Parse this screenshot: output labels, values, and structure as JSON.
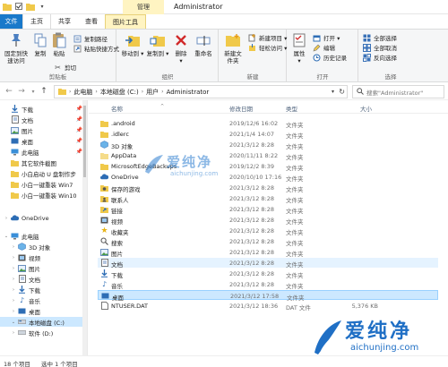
{
  "titlebar": {
    "manage_tab": "管理",
    "title": "Administrator"
  },
  "tabs": {
    "file": "文件",
    "home": "主页",
    "share": "共享",
    "view": "查看",
    "picture_tools": "图片工具"
  },
  "ribbon": {
    "clipboard": {
      "pin_label": "固定到快速访问",
      "copy_label": "复制",
      "paste_label": "粘贴",
      "copy_path_label": "复制路径",
      "paste_shortcut_label": "粘贴快捷方式",
      "cut_label": "剪切",
      "group_label": "剪贴板"
    },
    "organize": {
      "move_to_label": "移动到",
      "copy_to_label": "复制到",
      "delete_label": "删除",
      "rename_label": "重命名",
      "group_label": "组织"
    },
    "new": {
      "new_folder_label": "新建文件夹",
      "new_item_label": "新建项目",
      "easy_access_label": "轻松访问",
      "group_label": "新建"
    },
    "open": {
      "properties_label": "属性",
      "open_label": "打开",
      "edit_label": "编辑",
      "history_label": "历史记录",
      "group_label": "打开"
    },
    "select": {
      "select_all_label": "全部选择",
      "select_none_label": "全部取消",
      "invert_label": "反向选择",
      "group_label": "选择"
    }
  },
  "address": {
    "crumbs": [
      "此电脑",
      "本地磁盘 (C:)",
      "用户",
      "Administrator"
    ],
    "search_placeholder": "搜索\"Administrator\""
  },
  "sidebar": {
    "items": [
      {
        "label": "下载",
        "icon": "download-icon",
        "pinned": true
      },
      {
        "label": "文档",
        "icon": "document-icon",
        "pinned": true
      },
      {
        "label": "图片",
        "icon": "picture-icon",
        "pinned": true
      },
      {
        "label": "桌面",
        "icon": "desktop-icon",
        "pinned": true
      },
      {
        "label": "此电脑",
        "icon": "computer-icon",
        "pinned": true
      },
      {
        "label": "其它软件截图",
        "icon": "folder-icon",
        "pinned": false
      },
      {
        "label": "小白启动 U 盘制作步",
        "icon": "folder-icon",
        "pinned": false
      },
      {
        "label": "小白一键重装 Win7",
        "icon": "folder-icon",
        "pinned": false
      },
      {
        "label": "小白一键重装 Win10",
        "icon": "folder-icon",
        "pinned": false
      },
      {
        "label": "OneDrive",
        "icon": "cloud-icon",
        "pinned": false
      },
      {
        "label": "此电脑",
        "icon": "computer-icon",
        "pinned": false
      },
      {
        "label": "3D 对象",
        "icon": "cube-icon",
        "pinned": false
      },
      {
        "label": "视频",
        "icon": "video-icon",
        "pinned": false
      },
      {
        "label": "图片",
        "icon": "picture-icon",
        "pinned": false
      },
      {
        "label": "文档",
        "icon": "document-icon",
        "pinned": false
      },
      {
        "label": "下载",
        "icon": "download-icon",
        "pinned": false
      },
      {
        "label": "音乐",
        "icon": "music-icon",
        "pinned": false
      },
      {
        "label": "桌面",
        "icon": "desktop-icon",
        "pinned": false
      },
      {
        "label": "本地磁盘 (C:)",
        "icon": "drive-icon",
        "pinned": false
      },
      {
        "label": "软件 (D:)",
        "icon": "drive-icon",
        "pinned": false
      }
    ]
  },
  "columns": {
    "name": "名称",
    "date": "修改日期",
    "type": "类型",
    "size": "大小"
  },
  "files": [
    {
      "name": ".android",
      "date": "2019/12/6 16:02",
      "type": "文件夹",
      "size": "",
      "icon": "folder-icon"
    },
    {
      "name": ".idlerc",
      "date": "2021/1/4 14:07",
      "type": "文件夹",
      "size": "",
      "icon": "folder-icon"
    },
    {
      "name": "3D 对象",
      "date": "2021/3/12 8:28",
      "type": "文件夹",
      "size": "",
      "icon": "cube-icon"
    },
    {
      "name": "AppData",
      "date": "2020/11/11 8:22",
      "type": "文件夹",
      "size": "",
      "icon": "folder-icon"
    },
    {
      "name": "MicrosoftEdgeBackups",
      "date": "2019/12/2 8:39",
      "type": "文件夹",
      "size": "",
      "icon": "folder-icon"
    },
    {
      "name": "OneDrive",
      "date": "2020/10/10 17:16",
      "type": "文件夹",
      "size": "",
      "icon": "cloud-icon"
    },
    {
      "name": "保存的游戏",
      "date": "2021/3/12 8:28",
      "type": "文件夹",
      "size": "",
      "icon": "gamepad-icon"
    },
    {
      "name": "联系人",
      "date": "2021/3/12 8:28",
      "type": "文件夹",
      "size": "",
      "icon": "contacts-icon"
    },
    {
      "name": "链接",
      "date": "2021/3/12 8:28",
      "type": "文件夹",
      "size": "",
      "icon": "link-icon"
    },
    {
      "name": "视频",
      "date": "2021/3/12 8:28",
      "type": "文件夹",
      "size": "",
      "icon": "video-icon"
    },
    {
      "name": "收藏夹",
      "date": "2021/3/12 8:28",
      "type": "文件夹",
      "size": "",
      "icon": "star-icon"
    },
    {
      "name": "搜索",
      "date": "2021/3/12 8:28",
      "type": "文件夹",
      "size": "",
      "icon": "search-icon"
    },
    {
      "name": "图片",
      "date": "2021/3/12 8:28",
      "type": "文件夹",
      "size": "",
      "icon": "picture-icon"
    },
    {
      "name": "文档",
      "date": "2021/3/12 8:28",
      "type": "文件夹",
      "size": "",
      "icon": "document-icon"
    },
    {
      "name": "下载",
      "date": "2021/3/12 8:28",
      "type": "文件夹",
      "size": "",
      "icon": "download-icon"
    },
    {
      "name": "音乐",
      "date": "2021/3/12 8:28",
      "type": "文件夹",
      "size": "",
      "icon": "music-icon"
    },
    {
      "name": "桌面",
      "date": "2021/3/12 17:58",
      "type": "文件夹",
      "size": "",
      "icon": "desktop-icon"
    },
    {
      "name": "NTUSER.DAT",
      "date": "2021/3/12 18:36",
      "type": "DAT 文件",
      "size": "5,376 KB",
      "icon": "file-icon"
    }
  ],
  "status": {
    "count": "18 个项目",
    "selected": "选中 1 个项目"
  },
  "watermark": {
    "cn": "爱纯净",
    "en": "aichunjing.com"
  },
  "colors": {
    "accent": "#1979ca",
    "selection": "#cce8ff",
    "highlight": "#e5f3ff",
    "picture_tools": "#fff4c2"
  }
}
